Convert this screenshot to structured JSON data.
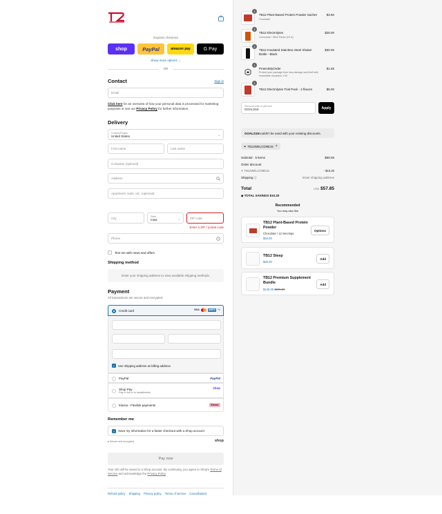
{
  "express": {
    "label": "Express checkout",
    "shop_pay": "shop",
    "paypal": "PayPal",
    "amazon_pay": "amazon pay",
    "google_pay": "G Pay",
    "show_more": "Show more options ⌄",
    "or": "OR"
  },
  "contact": {
    "heading": "Contact",
    "sign_in": "Sign in",
    "email_placeholder": "Email",
    "note_link1": "Click here",
    "note_text1": " for an overview of how your personal data is processed for marketing purposes or see our ",
    "note_link2": "Privacy Policy",
    "note_text2": " for further information."
  },
  "delivery": {
    "heading": "Delivery",
    "country_label": "Country/Region",
    "country_value": "United States",
    "first_name": "First name",
    "last_name": "Last name",
    "company": "Company (optional)",
    "address": "Address",
    "apartment": "Apartment, suite, etc. (optional)",
    "city": "City",
    "state_label": "State",
    "state_value": "Iowa",
    "zip": "ZIP code",
    "zip_error": "Enter a ZIP / postal code",
    "phone": "Phone",
    "news_label": "Text me with news and offers"
  },
  "shipping": {
    "heading": "Shipping method",
    "placeholder": "Enter your shipping address to view available shipping methods."
  },
  "payment": {
    "heading": "Payment",
    "subtext": "All transactions are secure and encrypted.",
    "credit_card": "Credit card",
    "card_brands": [
      "VISA",
      "MC",
      "AMEX",
      "+1"
    ],
    "billing_label": "Use shipping address as billing address",
    "paypal": "PayPal",
    "paypal_brand": "PayPal",
    "shop_pay": "Shop Pay",
    "shop_pay_sub": "Pay in full or in installments",
    "shop_brand": "shop",
    "klarna": "Klarna - Flexible payments",
    "klarna_brand": "Klarna."
  },
  "remember": {
    "heading": "Remember me",
    "save_label": "Save my information for a faster checkout with a Shop account",
    "secure": "Secure and encrypted",
    "shop_brand": "shop"
  },
  "pay_now": "Pay now",
  "legal": {
    "text1": "Your info will be saved to a Shop account. By continuing, you agree to Shop's ",
    "terms": "Terms of Service",
    "text2": " and acknowledge the ",
    "privacy": "Privacy Policy",
    "text3": "."
  },
  "footer_links": [
    "Refund policy",
    "Shipping",
    "Privacy policy",
    "Terms of service",
    "Cancellations"
  ],
  "cart": {
    "items": [
      {
        "qty": "1",
        "name": "TB12 Plant-Based Protein Powder Sachet",
        "sub": "Chocolate",
        "price": "$3.50",
        "color": "#c0392b"
      },
      {
        "qty": "1",
        "name": "TB12 Electrolytes",
        "sub": "Lemonade / Stick Packs (15 ct)",
        "price": "$28.00",
        "color": "#d35400"
      },
      {
        "qty": "1",
        "name": "TB12 Insulated Stainless Steel Shaker Bottle - Black",
        "sub": "",
        "price": "$30.00",
        "color": "#111111"
      },
      {
        "qty": "1",
        "name": "ProtectMyOrder",
        "sub": "Protect your package from loss damage and theft with immediate resolution 1.00",
        "price": "$1.55",
        "color": "#555555"
      },
      {
        "qty": "1",
        "name": "TB12 Electrolytes Trial Pack - 4 flavors",
        "sub": "",
        "price": "$5.00",
        "color": "#c0392b"
      }
    ],
    "discount_label": "Discount code or gift card",
    "discount_value": "GOALS15",
    "apply": "Apply",
    "discount_error_code": "GOALS15",
    "discount_error_text": " couldn't be used with your existing discounts.",
    "applied_tag": "TB12WELCOME15",
    "subtotal_label": "Subtotal · 5 items",
    "subtotal_value": "$68.05",
    "order_discount_label": "Order discount",
    "discount_code": "TB12WELCOME15",
    "discount_amount": "- $10.20",
    "shipping_label": "Shipping",
    "shipping_value": "Enter shipping address",
    "total_label": "Total",
    "currency": "USD",
    "total_value": "$57.85",
    "savings_label": "TOTAL SAVINGS",
    "savings_value": "$10.20"
  },
  "recommended": {
    "heading": "Recommended",
    "subheading": "You may also like",
    "items": [
      {
        "name": "TB12 Plant-Based Protein Powder",
        "sub": "Chocolate / 12 Servings",
        "price": "$34.00",
        "old_price": "",
        "button": "Options"
      },
      {
        "name": "TB12 Sleep",
        "sub": "",
        "price": "$40.00",
        "old_price": "",
        "button": "Add"
      },
      {
        "name": "TB12 Premium Supplement Bundle",
        "sub": "",
        "price": "$145.00",
        "old_price": "$205.00",
        "button": "Add"
      }
    ]
  },
  "colors": {
    "accent": "#1773b0",
    "error": "#dd1d1d",
    "shop": "#5a31f4",
    "paypal": "#ffc439",
    "brand_red": "#c8102e"
  }
}
